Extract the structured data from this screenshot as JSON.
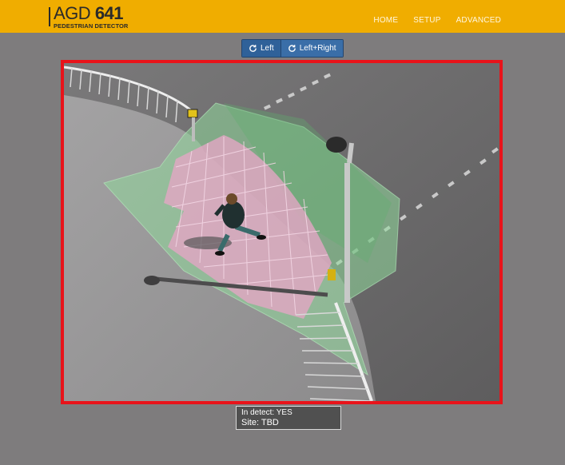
{
  "header": {
    "brand_prefix": "AGD",
    "brand_number": "641",
    "brand_subtitle": "PEDESTRIAN DETECTOR",
    "nav": [
      "HOME",
      "SETUP",
      "ADVANCED"
    ]
  },
  "view_controls": {
    "left_label": "Left",
    "left_right_label": "Left+Right"
  },
  "status": {
    "in_detect": "In detect: YES",
    "site": "Site: TBD"
  },
  "colors": {
    "topbar": "#f0ad00",
    "viewport_border": "#e8131a",
    "button": "#2f6199",
    "detection_zone": "#e3a6c4",
    "field_zone": "#9ae2a4"
  },
  "icons": {
    "rotate": "rotate-icon"
  }
}
